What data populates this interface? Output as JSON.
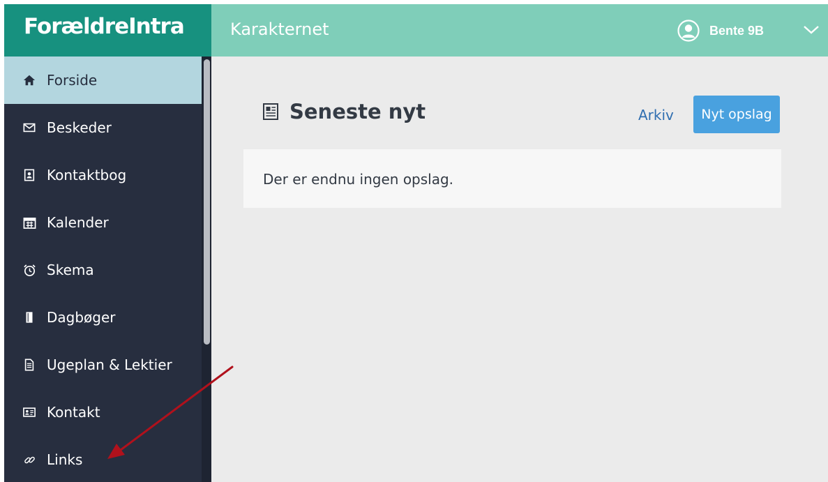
{
  "brand": {
    "logo": "ForældreIntra"
  },
  "header": {
    "site_title": "Karakternet",
    "user_name": "Bente 9B",
    "user_icon": "user-avatar-icon",
    "menu_icon": "chevron-down-icon"
  },
  "sidebar": {
    "items": [
      {
        "label": "Forside",
        "icon": "home-icon",
        "active": true
      },
      {
        "label": "Beskeder",
        "icon": "envelope-icon"
      },
      {
        "label": "Kontaktbog",
        "icon": "contact-book-icon"
      },
      {
        "label": "Kalender",
        "icon": "calendar-icon"
      },
      {
        "label": "Skema",
        "icon": "alarm-clock-icon"
      },
      {
        "label": "Dagbøger",
        "icon": "book-icon"
      },
      {
        "label": "Ugeplan & Lektier",
        "icon": "document-icon"
      },
      {
        "label": "Kontakt",
        "icon": "contact-card-icon"
      },
      {
        "label": "Links",
        "icon": "link-icon"
      }
    ]
  },
  "main": {
    "section_title": "Seneste nyt",
    "section_icon": "newspaper-icon",
    "archive_label": "Arkiv",
    "new_post_label": "Nyt opslag",
    "empty_message": "Der er endnu ingen opslag."
  },
  "colors": {
    "logo_bar": "#17917f",
    "header": "#7fceb9",
    "sidebar": "#272e3f",
    "active_item": "#b3d6df",
    "button": "#49a1df",
    "link": "#2f6eb0",
    "annotation_arrow": "#b0111c"
  }
}
